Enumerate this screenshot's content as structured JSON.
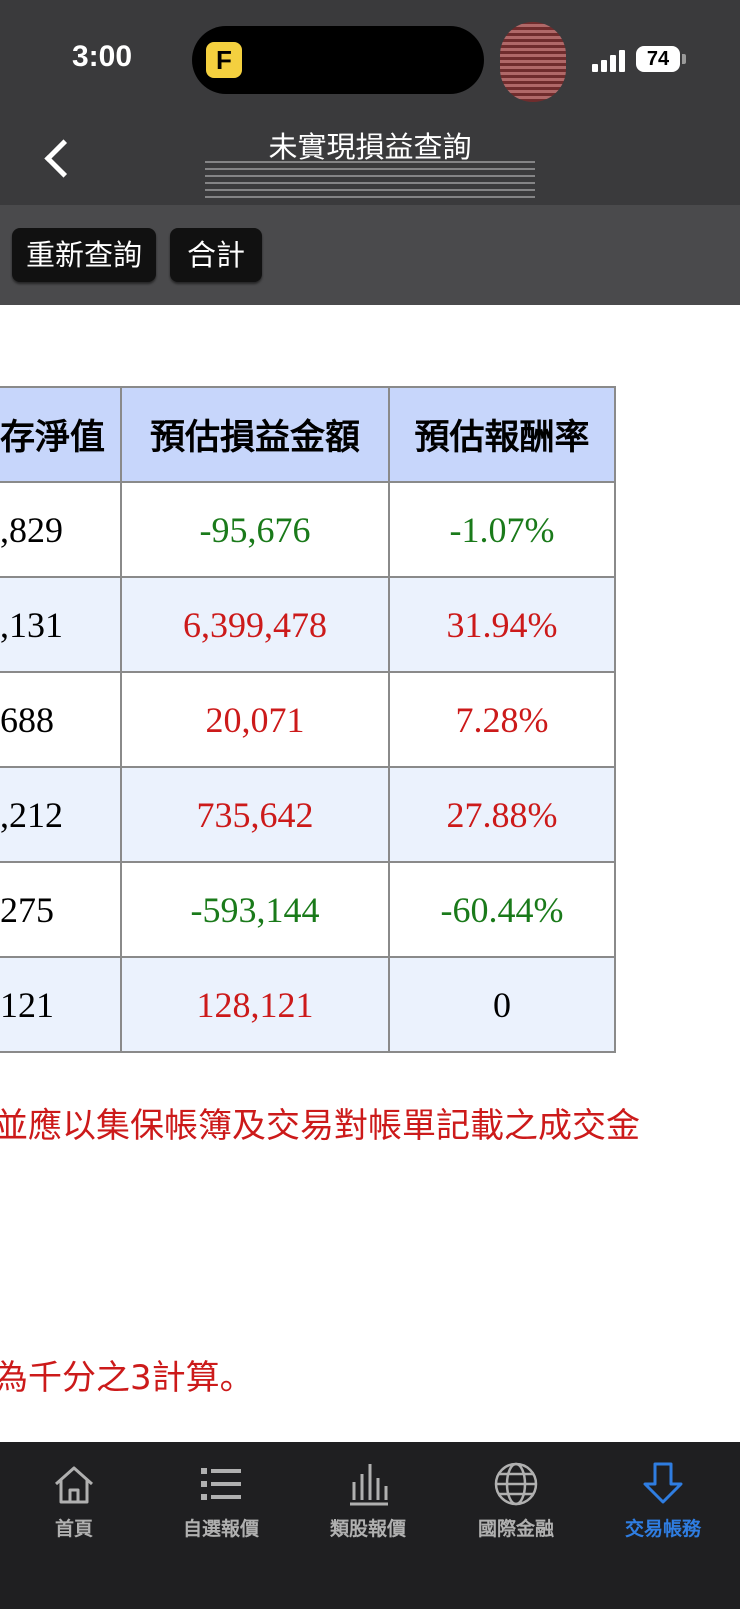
{
  "status": {
    "time": "3:00",
    "battery": "74",
    "app_badge": "F"
  },
  "header": {
    "title": "未實現損益查詢",
    "back_label": "<"
  },
  "toolbar": {
    "requery_label": "重新查詢",
    "total_label": "合計"
  },
  "table": {
    "columns": [
      "存淨值",
      "預估損益金額",
      "預估報酬率"
    ],
    "rows": [
      {
        "net": ",829",
        "pnl": "-95,676",
        "rate": "-1.07%",
        "tone": "green"
      },
      {
        "net": ",131",
        "pnl": "6,399,478",
        "rate": "31.94%",
        "tone": "red"
      },
      {
        "net": "688",
        "pnl": "20,071",
        "rate": "7.28%",
        "tone": "red"
      },
      {
        "net": ",212",
        "pnl": "735,642",
        "rate": "27.88%",
        "tone": "red"
      },
      {
        "net": "275",
        "pnl": "-593,144",
        "rate": "-60.44%",
        "tone": "green"
      },
      {
        "net": "121",
        "pnl": "128,121",
        "rate": "0",
        "tone": "mixed"
      }
    ]
  },
  "notes": {
    "line1": "並應以集保帳簿及交易對帳單記載之成交金",
    "line2": "為千分之3計算。"
  },
  "tabbar": {
    "items": [
      {
        "label": "首頁",
        "icon": "home-icon"
      },
      {
        "label": "自選報價",
        "icon": "list-icon"
      },
      {
        "label": "類股報價",
        "icon": "bar-chart-icon"
      },
      {
        "label": "國際金融",
        "icon": "globe-icon"
      },
      {
        "label": "交易帳務",
        "icon": "download-arrow-icon",
        "active": true
      }
    ]
  },
  "colors": {
    "gain": "#cc1a1a",
    "loss": "#1a7a1a",
    "header_bg": "#c7d6fb",
    "active_tab": "#2f7de1"
  }
}
